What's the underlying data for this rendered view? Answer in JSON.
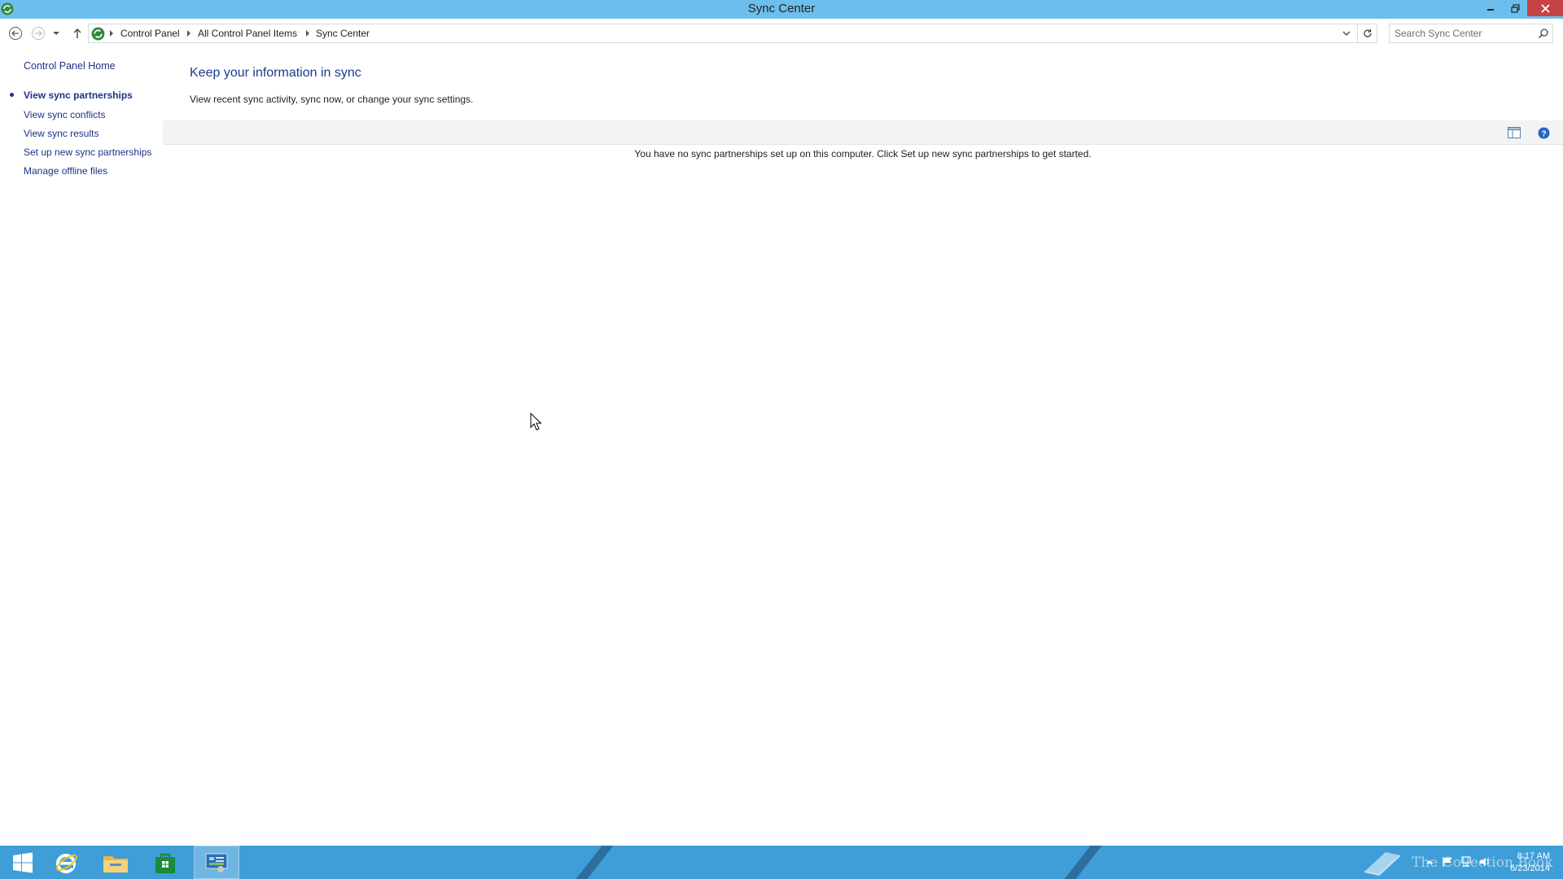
{
  "window": {
    "title": "Sync Center",
    "app_icon": "sync-center-icon",
    "controls": [
      "minimize-icon",
      "restore-icon",
      "close-icon"
    ],
    "close_color": "#c74343",
    "titlebar_color": "#6cbfed"
  },
  "navbar": {
    "breadcrumb": [
      "Control Panel",
      "All Control Panel Items",
      "Sync Center"
    ],
    "search_placeholder": "Search Sync Center"
  },
  "left_pane": {
    "home_link": "Control Panel Home",
    "links": [
      {
        "label": "View sync partnerships",
        "active": true
      },
      {
        "label": "View sync conflicts",
        "active": false
      },
      {
        "label": "View sync results",
        "active": false
      },
      {
        "label": "Set up new sync partnerships",
        "active": false
      },
      {
        "label": "Manage offline files",
        "active": false
      }
    ]
  },
  "main": {
    "title": "Keep your information in sync",
    "subtitle": "View recent sync activity, sync now, or change your sync settings.",
    "empty_message": "You have no sync partnerships set up on this computer. Click Set up new sync partnerships to get started.",
    "toolbar_icons": [
      "view-layout-icon",
      "help-icon"
    ]
  },
  "taskbar": {
    "apps": [
      "start-icon",
      "internet-explorer-icon",
      "file-explorer-icon",
      "store-icon",
      "control-panel-icon"
    ],
    "watermark": "The Collection Book",
    "clock": {
      "time": "8:17 AM",
      "date": "6/23/2014"
    },
    "color": "#3f9ed8"
  }
}
